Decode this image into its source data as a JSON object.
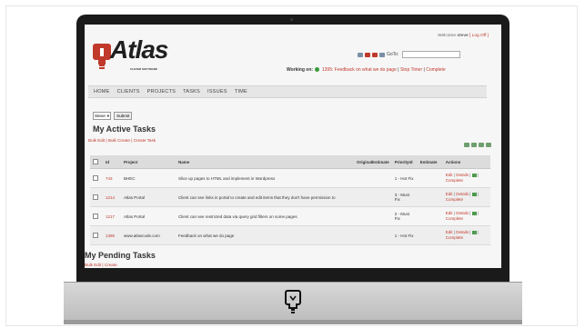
{
  "header": {
    "welcome_prefix": "Welcome",
    "username": "steve",
    "logout_label": "[ Log Off ]",
    "goto_label": "GoTo:",
    "goto_value": ""
  },
  "logo": {
    "name": "Atlas",
    "tagline": "CLEVER SOFTWARE"
  },
  "working_on": {
    "label": "Working on:",
    "task": "1395: Feedback on what we do page",
    "stop_timer": "Stop Timer",
    "complete": "Complete"
  },
  "nav": {
    "items": [
      "HOME",
      "CLIENTS",
      "PROJECTS",
      "TASKS",
      "ISSUES",
      "TIME"
    ]
  },
  "filter": {
    "selected_user": "Steve",
    "submit_label": "Submit"
  },
  "active_tasks": {
    "title": "My Active Tasks",
    "bulk_edit": "Bulk Edit",
    "bulk_create": "Bulk Create",
    "create_task": "Create Task",
    "columns": [
      "Id",
      "Project",
      "Name",
      "OriginalEstimate",
      "PriorityId",
      "Estimate",
      "Actions"
    ],
    "rows": [
      {
        "id": "743",
        "project": "BHEC",
        "name": "Slice up pages to HTML and implement in Wordpress",
        "original_estimate": "",
        "priority": "1 - Hot Fix",
        "estimate": ""
      },
      {
        "id": "1214",
        "project": "Atlas Portal",
        "name": "Client can see links in portal to create and edit items that they don't have permission to",
        "original_estimate": "",
        "priority": "3 - Must Fix",
        "estimate": ""
      },
      {
        "id": "1217",
        "project": "Atlas Portal",
        "name": "Client can see restricted data via query grid filters on some pages",
        "original_estimate": "",
        "priority": "2 - Must Fix",
        "estimate": ""
      },
      {
        "id": "1395",
        "project": "www.atlascode.com",
        "name": "Feedback on what we do page",
        "original_estimate": "",
        "priority": "1 - Hot Fix",
        "estimate": ""
      }
    ],
    "action_edit": "Edit",
    "action_details": "Details",
    "action_complete": "Complete"
  },
  "pending_tasks": {
    "title": "My Pending Tasks",
    "link": "Bulk Edit | Create"
  },
  "colors": {
    "accent_red": "#c0392b",
    "nav_bg": "#e6e6e6",
    "bezel": "#1a1a1a"
  }
}
